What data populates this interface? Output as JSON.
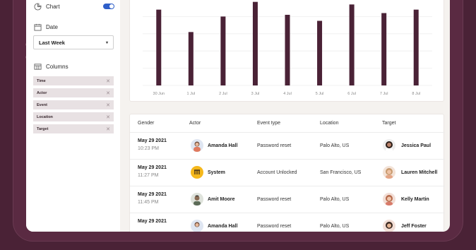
{
  "sidebar": {
    "chart_label": "Chart",
    "date_label": "Date",
    "date_value": "Last Week",
    "columns_label": "Columns",
    "columns": [
      "Time",
      "Actor",
      "Event",
      "Location",
      "Target"
    ]
  },
  "chart_data": {
    "type": "bar",
    "categories": [
      "30 Jun",
      "1 Jul",
      "2 Jul",
      "3 Jul",
      "4 Jul",
      "5 Jul",
      "6 Jul",
      "7 Jul",
      "8 Jul"
    ],
    "values": [
      88,
      62,
      80,
      97,
      82,
      75,
      94,
      84,
      88
    ],
    "ylim": [
      0,
      100
    ],
    "grid": true,
    "bar_color": "#4a2236"
  },
  "table": {
    "headers": [
      "Gender",
      "Actor",
      "Event type",
      "Location",
      "Target"
    ],
    "rows": [
      {
        "date": "May 29 2021",
        "time": "10:23 PM",
        "actor": "Amanda Hall",
        "event": "Password reset",
        "location": "Palo Alto, US",
        "target": "Jessica Paul"
      },
      {
        "date": "May 29 2021",
        "time": "11:27 PM",
        "actor": "System",
        "event": "Account Unlocked",
        "location": "San Francisco, US",
        "target": "Lauren Mitchell"
      },
      {
        "date": "May 29 2021",
        "time": "11:45 PM",
        "actor": "Amit Moore",
        "event": "Password reset",
        "location": "Palo Alto, US",
        "target": "Kelly Martin"
      },
      {
        "date": "May 29 2021",
        "time": "",
        "actor": "Amanda Hall",
        "event": "Password reset",
        "location": "Palo Alto, US",
        "target": "Jeff Foster"
      }
    ]
  },
  "colors": {
    "background": "#4a2236",
    "accent": "#2f5fc9",
    "bar": "#4a2236",
    "system_badge": "#f5b81c"
  }
}
